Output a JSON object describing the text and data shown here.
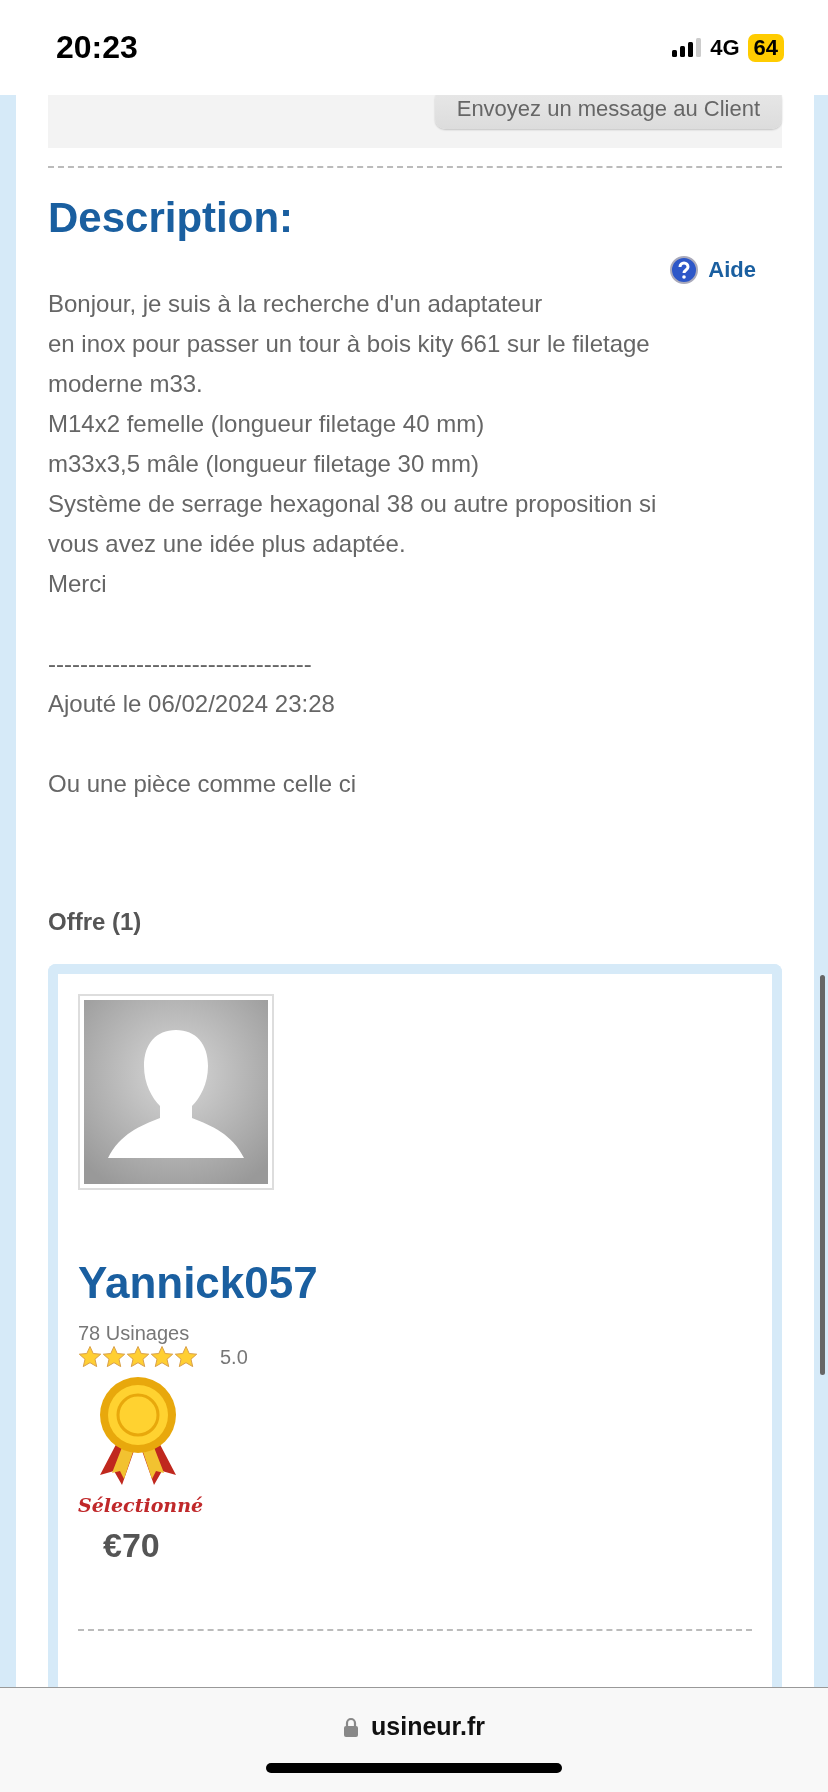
{
  "status_bar": {
    "time": "20:23",
    "network": "4G",
    "battery": "64"
  },
  "contact_button": {
    "label": "Envoyez un message au Client"
  },
  "description": {
    "title": "Description:",
    "help_link": "Aide",
    "lines": [
      "Bonjour, je suis à la recherche d'un adaptateur",
      "en inox pour passer un tour à bois kity 661 sur le filetage",
      "moderne m33.",
      "M14x2 femelle (longueur filetage 40 mm)",
      "m33x3,5 mâle (longueur filetage 30 mm)",
      "Système de serrage hexagonal 38 ou autre proposition si",
      "vous avez une idée plus adaptée.",
      "Merci"
    ],
    "separator": "---------------------------------",
    "added": "Ajouté le 06/02/2024 23:28",
    "addendum": "Ou une pièce comme celle ci"
  },
  "offers": {
    "title": "Offre (1)",
    "items": [
      {
        "name": "Yannick057",
        "jobs": "78 Usinages",
        "stars": 5,
        "rating": "5.0",
        "selected": true,
        "selected_label": "Sélectionné",
        "price": "€70"
      }
    ]
  },
  "browser_bar": {
    "url": "usineur.fr"
  }
}
